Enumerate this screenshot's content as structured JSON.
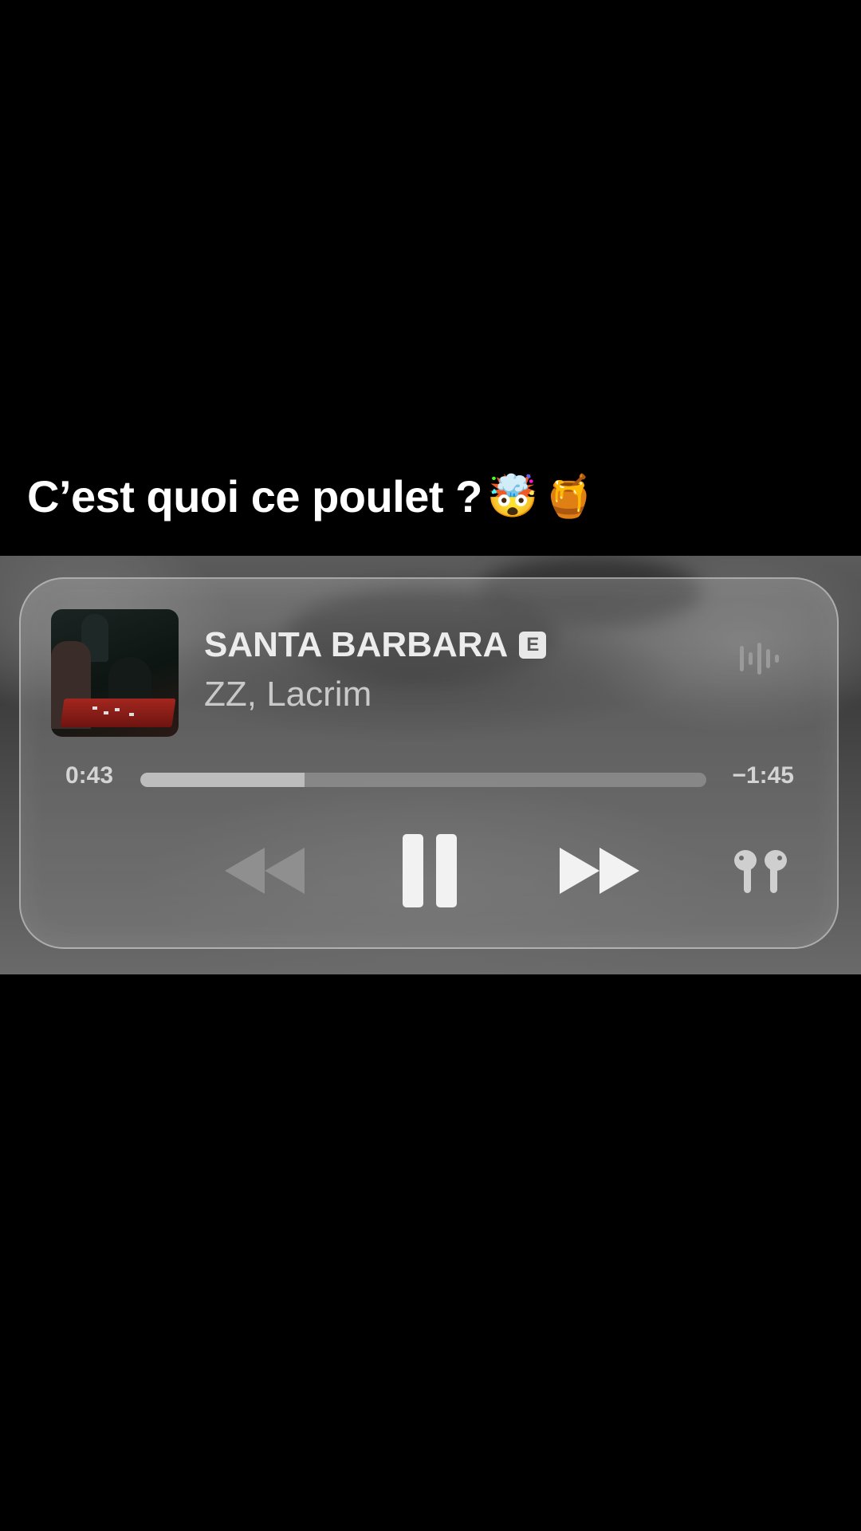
{
  "caption": {
    "text": "C’est quoi ce poulet ?",
    "emojis": [
      "🤯",
      "🍯"
    ]
  },
  "player": {
    "song_title": "SANTA BARBARA",
    "explicit_badge": "E",
    "artist": "ZZ, Lacrim",
    "elapsed": "0:43",
    "remaining": "−1:45",
    "progress": 0.29
  },
  "icons": {
    "rewind": "rewind-icon",
    "pause": "pause-icon",
    "forward": "fast-forward-icon",
    "airpods": "airpods-icon",
    "waveform": "waveform-icon"
  },
  "colors": {
    "background": "#000000",
    "controls_active": "#f2f2f2",
    "controls_dim": "#8f8f8f"
  }
}
